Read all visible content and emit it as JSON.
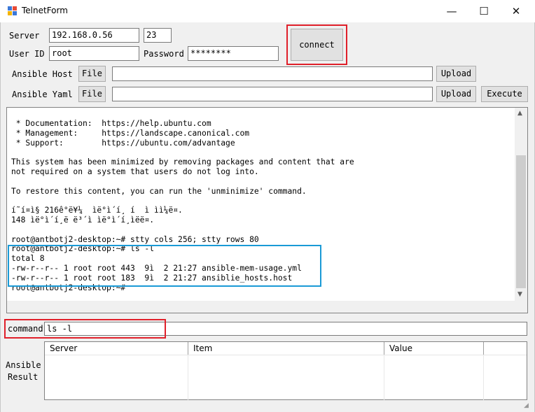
{
  "window": {
    "title": "TelnetForm",
    "minimize_glyph": "—",
    "maximize_glyph": "☐",
    "close_glyph": "✕"
  },
  "connection": {
    "server_label": "Server",
    "server_value": "192.168.0.56",
    "port_value": "23",
    "userid_label": "User ID",
    "userid_value": "root",
    "password_label": "Password",
    "password_value": "********",
    "connect_label": "connect"
  },
  "ansible": {
    "host_label": "Ansible Host",
    "yaml_label": "Ansible Yaml",
    "file_label": "File",
    "upload_label": "Upload",
    "execute_label": "Execute",
    "host_path": "",
    "yaml_path": ""
  },
  "terminal": {
    "text": " * Documentation:  https://help.ubuntu.com\n * Management:     https://landscape.canonical.com\n * Support:        https://ubuntu.com/advantage\n\nThis system has been minimized by removing packages and content that are\nnot required on a system that users do not log into.\n\nTo restore this content, you can run the 'unminimize' command.\n\ní˜í¤ì§ 216ê°ë¥¼  ìë°ì´í¸ í  ì ìì¼ë¤.\n148 ìë°ì´í¸ë ë³´ì ìë°ì´í¸ìëë¤.\n\nroot@antbotj2-desktop:~# stty cols 256; stty rows 80\nroot@antbotj2-desktop:~# ls -l\ntotal 8\n-rw-r--r-- 1 root root 443  9ì  2 21:27 ansible-mem-usage.yml\n-rw-r--r-- 1 root root 183  9ì  2 21:27 ansiblie_hosts.host\nroot@antbotj2-desktop:~#"
  },
  "command": {
    "label": "command",
    "value": "ls -l"
  },
  "result": {
    "label_line1": "Ansible",
    "label_line2": "Result",
    "columns": [
      "Server",
      "Item",
      "Value"
    ]
  },
  "colors": {
    "highlight_red": "#e0202a",
    "highlight_blue": "#1a9ad6"
  }
}
